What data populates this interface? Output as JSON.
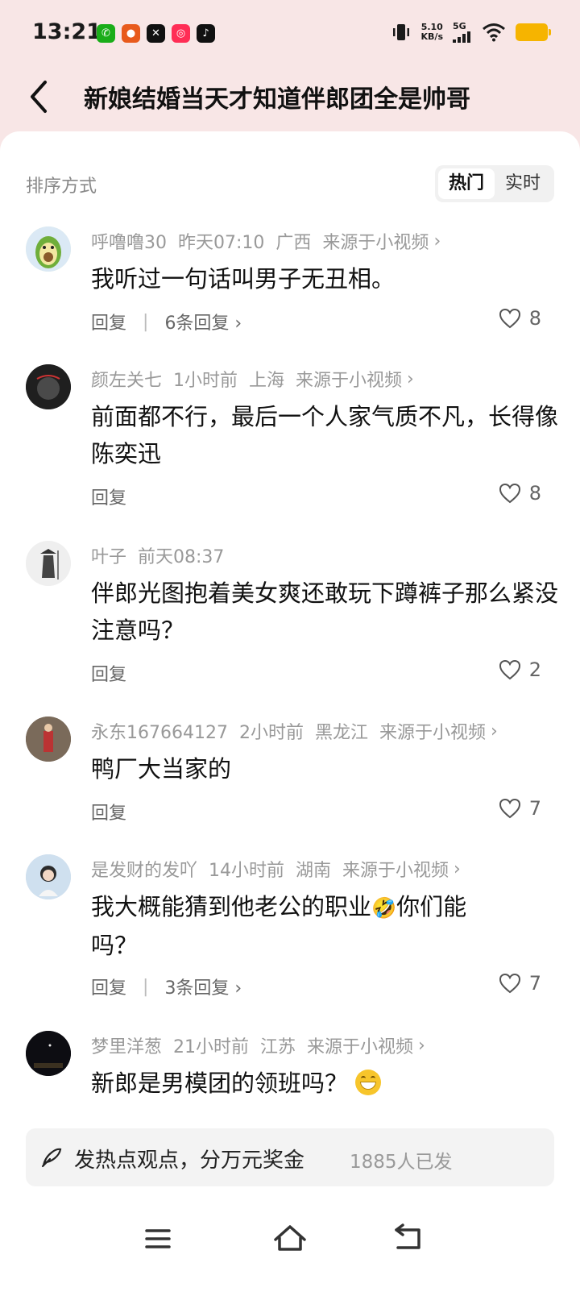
{
  "status_bar": {
    "time": "13:21",
    "speed_value": "5.10",
    "speed_unit": "KB/s",
    "network": "5G",
    "app_icons": [
      {
        "name": "wechat-icon",
        "color": "#1aad19",
        "glyph": "✆"
      },
      {
        "name": "pumpkin-app-icon",
        "color": "#e85a1c",
        "glyph": "●"
      },
      {
        "name": "capcut-icon",
        "color": "#111111",
        "glyph": "✕"
      },
      {
        "name": "kuaishou-icon",
        "color": "#ff2d55",
        "glyph": "◎"
      },
      {
        "name": "tiktok-icon",
        "color": "#111111",
        "glyph": "♪"
      }
    ]
  },
  "header": {
    "title": "新娘结婚当天才知道伴郎团全是帅哥"
  },
  "sort": {
    "label": "排序方式",
    "options": [
      "热门",
      "实时"
    ],
    "active": "热门"
  },
  "comments": [
    {
      "user": "呼噜噜30",
      "time": "昨天07:10",
      "location": "广西",
      "source": "来源于小视频",
      "text": "我听过一句话叫男子无丑相。",
      "reply_label": "回复",
      "replies": "6条回复",
      "likes": "8",
      "avatar_color": "#a8d56a"
    },
    {
      "user": "颜左关七",
      "time": "1小时前",
      "location": "上海",
      "source": "来源于小视频",
      "text": "前面都不行，最后一个人家气质不凡，长得像陈奕迅",
      "reply_label": "回复",
      "replies": "",
      "likes": "8",
      "avatar_color": "#2a2a2a"
    },
    {
      "user": "叶子",
      "time": "前天08:37",
      "location": "",
      "source": "",
      "text": "伴郎光图抱着美女爽还敢玩下蹲裤子那么紧没注意吗？",
      "reply_label": "回复",
      "replies": "",
      "likes": "2",
      "avatar_color": "#e8e8e8"
    },
    {
      "user": "永东167664127",
      "time": "2小时前",
      "location": "黑龙江",
      "source": "来源于小视频",
      "text": "鸭厂大当家的",
      "reply_label": "回复",
      "replies": "",
      "likes": "7",
      "avatar_color": "#6b5a4a"
    },
    {
      "user": "是发财的发吖",
      "time": "14小时前",
      "location": "湖南",
      "source": "来源于小视频",
      "text_before": "我大概能猜到他老公的职业",
      "text_emoji": "🤣",
      "text_after": "你们能吗？",
      "reply_label": "回复",
      "replies": "3条回复",
      "likes": "7",
      "avatar_color": "#c9d7e8"
    },
    {
      "user": "梦里洋葱",
      "time": "21小时前",
      "location": "江苏",
      "source": "来源于小视频",
      "text": "新郎是男模团的领班吗？",
      "avatar_color": "#0d0d12"
    }
  ],
  "post_bar": {
    "prompt": "发热点观点，分万元奖金",
    "count": "1885人已发"
  }
}
